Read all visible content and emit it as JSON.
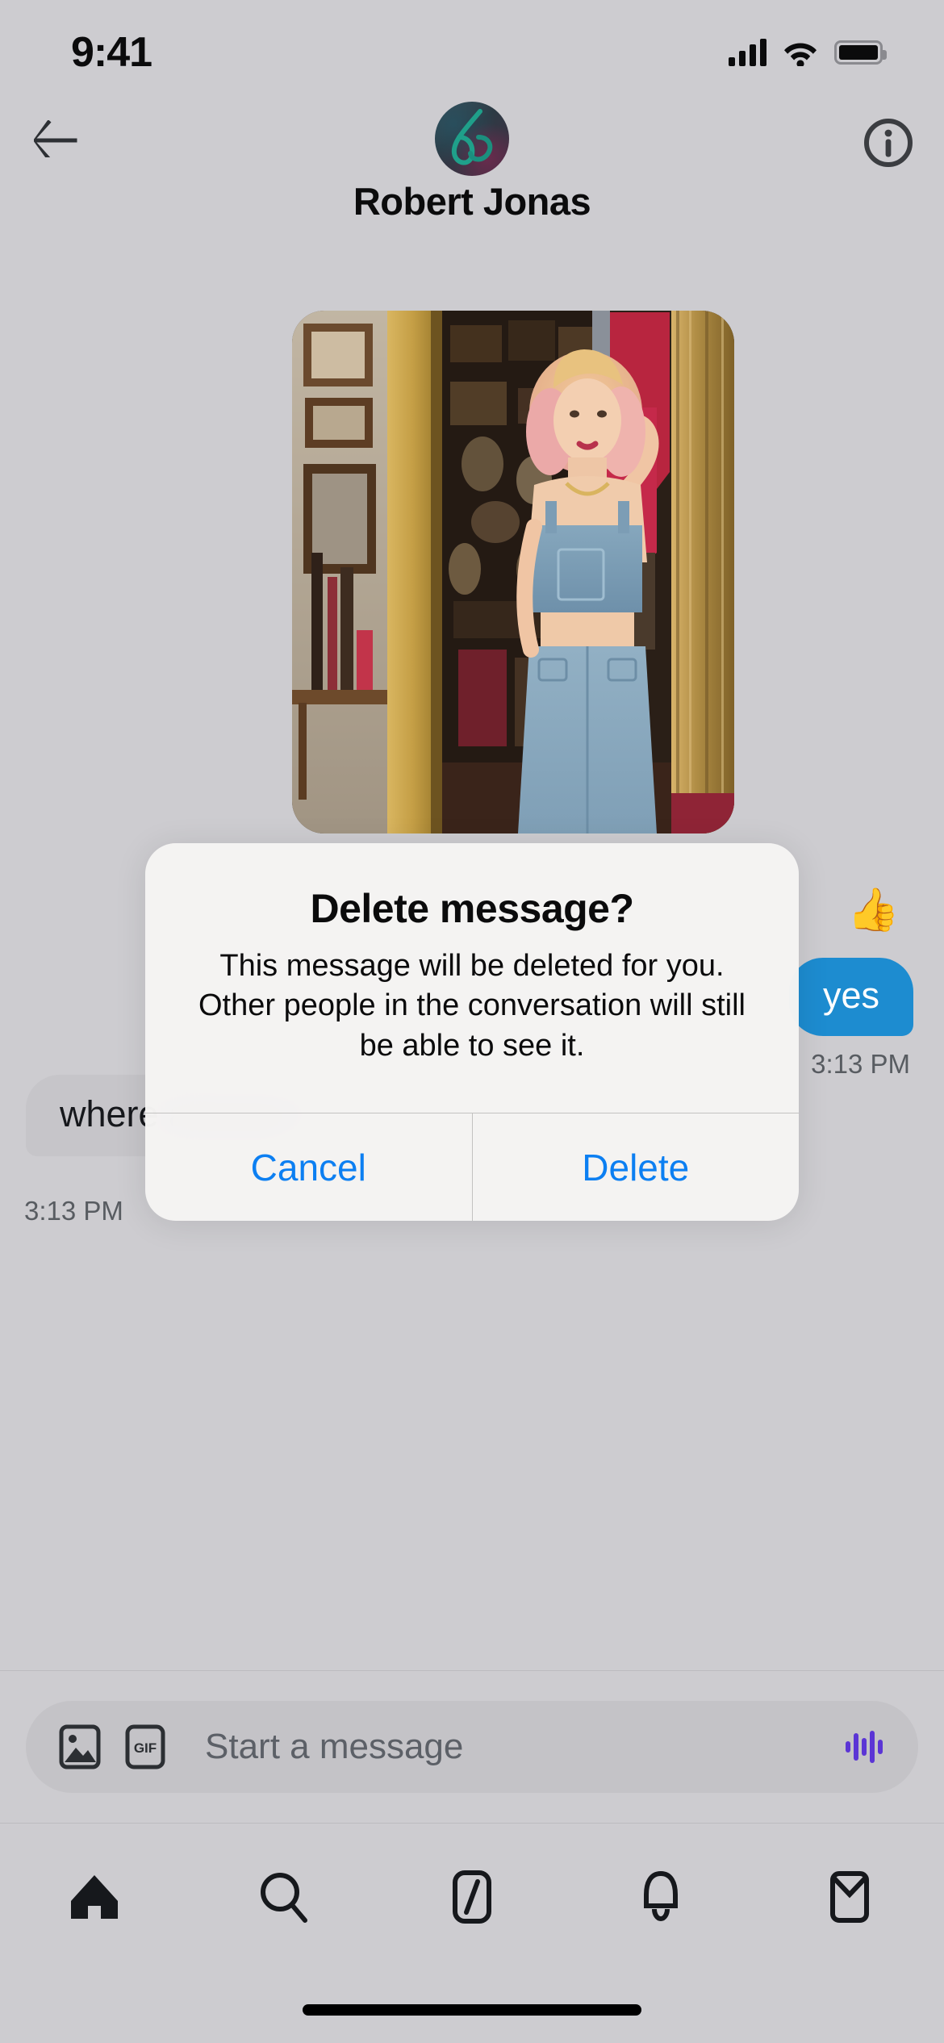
{
  "status_bar": {
    "time": "9:41",
    "icons": [
      "cellular-signal-icon",
      "wifi-icon",
      "battery-icon"
    ]
  },
  "header": {
    "back_icon": "back-arrow-icon",
    "info_icon": "info-circle-icon",
    "avatar_label": "avatar",
    "peer_name": "Robert Jonas"
  },
  "conversation": {
    "messages": [
      {
        "type": "image",
        "direction": "incoming",
        "alt": "Woman with pink blonde hair in denim overalls standing in a vintage shop",
        "reaction": "👍"
      },
      {
        "type": "text",
        "direction": "outgoing",
        "text": "yes",
        "timestamp": "3:13 PM"
      },
      {
        "type": "text",
        "direction": "incoming",
        "text": "where are you ?",
        "timestamp": "3:13 PM",
        "reaction_button": "add-reaction-heart-icon"
      }
    ]
  },
  "dialog": {
    "title": "Delete message?",
    "body": "This message will be deleted for you. Other people in the conversation will still be able to see it.",
    "cancel_label": "Cancel",
    "delete_label": "Delete",
    "accent_color": "#0c7ff2"
  },
  "composer": {
    "placeholder": "Start a message",
    "image_icon": "image-picker-icon",
    "gif_icon": "gif-icon",
    "audio_icon": "audio-waveform-icon",
    "audio_color": "#5b35d5"
  },
  "tabbar": {
    "items": [
      {
        "name": "home",
        "icon": "home-icon",
        "active": true
      },
      {
        "name": "explore",
        "icon": "search-icon",
        "active": false
      },
      {
        "name": "grok",
        "icon": "grok-slash-icon",
        "active": false
      },
      {
        "name": "notifications",
        "icon": "bell-icon",
        "active": false
      },
      {
        "name": "messages",
        "icon": "envelope-icon",
        "active": false
      }
    ]
  },
  "colors": {
    "background": "#cdccd0",
    "outgoing_bubble": "#1d8cd0",
    "incoming_bubble": "#c6c5c9",
    "timestamp": "#585c61"
  }
}
